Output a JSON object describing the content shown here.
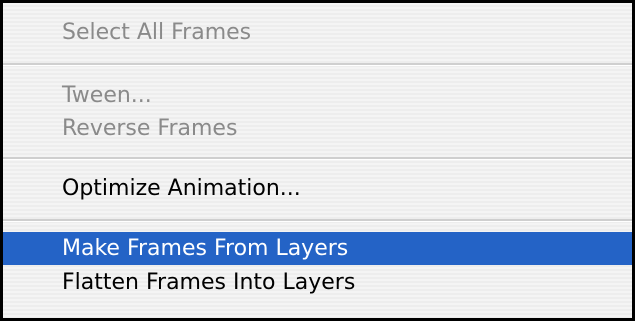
{
  "menu": {
    "items": [
      {
        "label": "Select All Frames",
        "state": "disabled"
      },
      {
        "label": "Tween...",
        "state": "disabled"
      },
      {
        "label": "Reverse Frames",
        "state": "disabled"
      },
      {
        "label": "Optimize Animation...",
        "state": "enabled"
      },
      {
        "label": "Make Frames From Layers",
        "state": "highlighted"
      },
      {
        "label": "Flatten Frames Into Layers",
        "state": "enabled"
      }
    ],
    "colors": {
      "highlight": "#2463c6",
      "disabled_text": "#8a8a8a",
      "enabled_text": "#000000"
    }
  }
}
